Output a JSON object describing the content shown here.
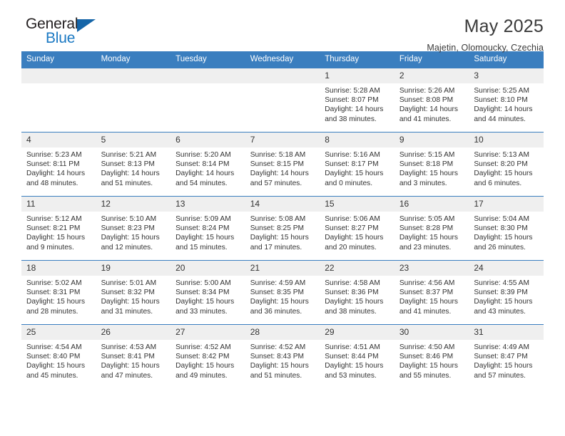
{
  "brand": {
    "name_part1": "General",
    "name_part2": "Blue",
    "triangle_color": "#1565a8",
    "blue_color": "#1b79c3"
  },
  "header": {
    "title": "May 2025",
    "subtitle": "Majetin, Olomoucky, Czechia"
  },
  "theme": {
    "header_bg": "#3a7ebf",
    "daynum_bg": "#efefef",
    "row_divider": "#3a7ebf",
    "text": "#333333"
  },
  "weekday_headers": [
    "Sunday",
    "Monday",
    "Tuesday",
    "Wednesday",
    "Thursday",
    "Friday",
    "Saturday"
  ],
  "labels": {
    "sunrise_prefix": "Sunrise: ",
    "sunset_prefix": "Sunset: ",
    "daylight_prefix": "Daylight: "
  },
  "weeks": [
    [
      {
        "day": "",
        "sunrise": "",
        "sunset": "",
        "daylight": ""
      },
      {
        "day": "",
        "sunrise": "",
        "sunset": "",
        "daylight": ""
      },
      {
        "day": "",
        "sunrise": "",
        "sunset": "",
        "daylight": ""
      },
      {
        "day": "",
        "sunrise": "",
        "sunset": "",
        "daylight": ""
      },
      {
        "day": "1",
        "sunrise": "Sunrise: 5:28 AM",
        "sunset": "Sunset: 8:07 PM",
        "daylight": "Daylight: 14 hours and 38 minutes."
      },
      {
        "day": "2",
        "sunrise": "Sunrise: 5:26 AM",
        "sunset": "Sunset: 8:08 PM",
        "daylight": "Daylight: 14 hours and 41 minutes."
      },
      {
        "day": "3",
        "sunrise": "Sunrise: 5:25 AM",
        "sunset": "Sunset: 8:10 PM",
        "daylight": "Daylight: 14 hours and 44 minutes."
      }
    ],
    [
      {
        "day": "4",
        "sunrise": "Sunrise: 5:23 AM",
        "sunset": "Sunset: 8:11 PM",
        "daylight": "Daylight: 14 hours and 48 minutes."
      },
      {
        "day": "5",
        "sunrise": "Sunrise: 5:21 AM",
        "sunset": "Sunset: 8:13 PM",
        "daylight": "Daylight: 14 hours and 51 minutes."
      },
      {
        "day": "6",
        "sunrise": "Sunrise: 5:20 AM",
        "sunset": "Sunset: 8:14 PM",
        "daylight": "Daylight: 14 hours and 54 minutes."
      },
      {
        "day": "7",
        "sunrise": "Sunrise: 5:18 AM",
        "sunset": "Sunset: 8:15 PM",
        "daylight": "Daylight: 14 hours and 57 minutes."
      },
      {
        "day": "8",
        "sunrise": "Sunrise: 5:16 AM",
        "sunset": "Sunset: 8:17 PM",
        "daylight": "Daylight: 15 hours and 0 minutes."
      },
      {
        "day": "9",
        "sunrise": "Sunrise: 5:15 AM",
        "sunset": "Sunset: 8:18 PM",
        "daylight": "Daylight: 15 hours and 3 minutes."
      },
      {
        "day": "10",
        "sunrise": "Sunrise: 5:13 AM",
        "sunset": "Sunset: 8:20 PM",
        "daylight": "Daylight: 15 hours and 6 minutes."
      }
    ],
    [
      {
        "day": "11",
        "sunrise": "Sunrise: 5:12 AM",
        "sunset": "Sunset: 8:21 PM",
        "daylight": "Daylight: 15 hours and 9 minutes."
      },
      {
        "day": "12",
        "sunrise": "Sunrise: 5:10 AM",
        "sunset": "Sunset: 8:23 PM",
        "daylight": "Daylight: 15 hours and 12 minutes."
      },
      {
        "day": "13",
        "sunrise": "Sunrise: 5:09 AM",
        "sunset": "Sunset: 8:24 PM",
        "daylight": "Daylight: 15 hours and 15 minutes."
      },
      {
        "day": "14",
        "sunrise": "Sunrise: 5:08 AM",
        "sunset": "Sunset: 8:25 PM",
        "daylight": "Daylight: 15 hours and 17 minutes."
      },
      {
        "day": "15",
        "sunrise": "Sunrise: 5:06 AM",
        "sunset": "Sunset: 8:27 PM",
        "daylight": "Daylight: 15 hours and 20 minutes."
      },
      {
        "day": "16",
        "sunrise": "Sunrise: 5:05 AM",
        "sunset": "Sunset: 8:28 PM",
        "daylight": "Daylight: 15 hours and 23 minutes."
      },
      {
        "day": "17",
        "sunrise": "Sunrise: 5:04 AM",
        "sunset": "Sunset: 8:30 PM",
        "daylight": "Daylight: 15 hours and 26 minutes."
      }
    ],
    [
      {
        "day": "18",
        "sunrise": "Sunrise: 5:02 AM",
        "sunset": "Sunset: 8:31 PM",
        "daylight": "Daylight: 15 hours and 28 minutes."
      },
      {
        "day": "19",
        "sunrise": "Sunrise: 5:01 AM",
        "sunset": "Sunset: 8:32 PM",
        "daylight": "Daylight: 15 hours and 31 minutes."
      },
      {
        "day": "20",
        "sunrise": "Sunrise: 5:00 AM",
        "sunset": "Sunset: 8:34 PM",
        "daylight": "Daylight: 15 hours and 33 minutes."
      },
      {
        "day": "21",
        "sunrise": "Sunrise: 4:59 AM",
        "sunset": "Sunset: 8:35 PM",
        "daylight": "Daylight: 15 hours and 36 minutes."
      },
      {
        "day": "22",
        "sunrise": "Sunrise: 4:58 AM",
        "sunset": "Sunset: 8:36 PM",
        "daylight": "Daylight: 15 hours and 38 minutes."
      },
      {
        "day": "23",
        "sunrise": "Sunrise: 4:56 AM",
        "sunset": "Sunset: 8:37 PM",
        "daylight": "Daylight: 15 hours and 41 minutes."
      },
      {
        "day": "24",
        "sunrise": "Sunrise: 4:55 AM",
        "sunset": "Sunset: 8:39 PM",
        "daylight": "Daylight: 15 hours and 43 minutes."
      }
    ],
    [
      {
        "day": "25",
        "sunrise": "Sunrise: 4:54 AM",
        "sunset": "Sunset: 8:40 PM",
        "daylight": "Daylight: 15 hours and 45 minutes."
      },
      {
        "day": "26",
        "sunrise": "Sunrise: 4:53 AM",
        "sunset": "Sunset: 8:41 PM",
        "daylight": "Daylight: 15 hours and 47 minutes."
      },
      {
        "day": "27",
        "sunrise": "Sunrise: 4:52 AM",
        "sunset": "Sunset: 8:42 PM",
        "daylight": "Daylight: 15 hours and 49 minutes."
      },
      {
        "day": "28",
        "sunrise": "Sunrise: 4:52 AM",
        "sunset": "Sunset: 8:43 PM",
        "daylight": "Daylight: 15 hours and 51 minutes."
      },
      {
        "day": "29",
        "sunrise": "Sunrise: 4:51 AM",
        "sunset": "Sunset: 8:44 PM",
        "daylight": "Daylight: 15 hours and 53 minutes."
      },
      {
        "day": "30",
        "sunrise": "Sunrise: 4:50 AM",
        "sunset": "Sunset: 8:46 PM",
        "daylight": "Daylight: 15 hours and 55 minutes."
      },
      {
        "day": "31",
        "sunrise": "Sunrise: 4:49 AM",
        "sunset": "Sunset: 8:47 PM",
        "daylight": "Daylight: 15 hours and 57 minutes."
      }
    ]
  ]
}
